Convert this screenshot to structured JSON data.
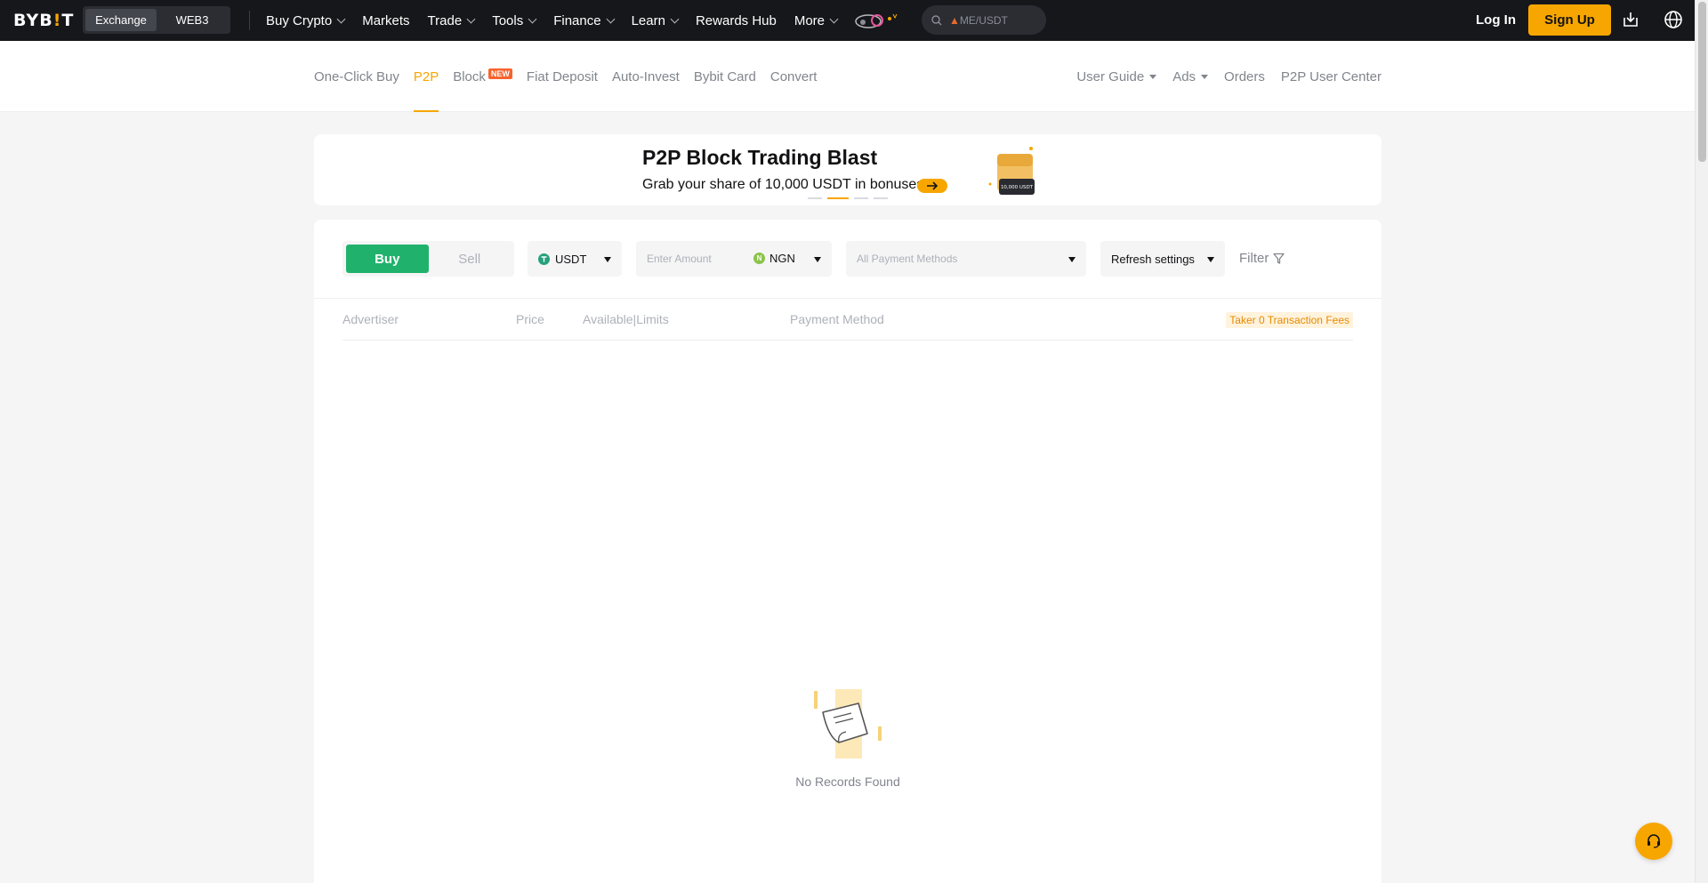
{
  "topnav": {
    "logo_main": "BYB",
    "logo_bar": "!",
    "logo_end": "T",
    "switch": [
      {
        "label": "Exchange",
        "active": true
      },
      {
        "label": "WEB3",
        "active": false
      }
    ],
    "items": [
      {
        "label": "Buy Crypto",
        "dropdown": true
      },
      {
        "label": "Markets",
        "dropdown": false
      },
      {
        "label": "Trade",
        "dropdown": true
      },
      {
        "label": "Tools",
        "dropdown": true
      },
      {
        "label": "Finance",
        "dropdown": true
      },
      {
        "label": "Learn",
        "dropdown": true
      },
      {
        "label": "Rewards Hub",
        "dropdown": false
      },
      {
        "label": "More",
        "dropdown": true
      }
    ],
    "search_placeholder": "ME/USDT",
    "login_label": "Log In",
    "signup_label": "Sign Up"
  },
  "subnav": {
    "left": [
      {
        "label": "One-Click Buy",
        "active": false
      },
      {
        "label": "P2P",
        "active": true
      },
      {
        "label": "Block",
        "active": false,
        "badge": "NEW"
      },
      {
        "label": "Fiat Deposit",
        "active": false
      },
      {
        "label": "Auto-Invest",
        "active": false
      },
      {
        "label": "Bybit Card",
        "active": false
      },
      {
        "label": "Convert",
        "active": false
      }
    ],
    "right": [
      {
        "label": "User Guide",
        "dropdown": true
      },
      {
        "label": "Ads",
        "dropdown": true
      },
      {
        "label": "Orders",
        "dropdown": false
      },
      {
        "label": "P2P User Center",
        "dropdown": false
      }
    ]
  },
  "banner": {
    "title": "P2P Block Trading Blast",
    "subtitle": "Grab your share of 10,000 USDT in bonuses!",
    "image_text": "10,000 USDT",
    "slide_active": 2,
    "slide_count": 4
  },
  "filters": {
    "buy_label": "Buy",
    "sell_label": "Sell",
    "mode": "Buy",
    "coin": "USDT",
    "amount_placeholder": "Enter Amount",
    "fiat": "NGN",
    "fiat_icon_letter": "N",
    "payment_placeholder": "All Payment Methods",
    "refresh_label": "Refresh settings",
    "filter_label": "Filter"
  },
  "table": {
    "columns": [
      "Advertiser",
      "Price",
      "Available|Limits",
      "Payment Method"
    ],
    "fees_badge": "Taker 0 Transaction Fees",
    "rows": [],
    "empty_text": "No Records Found"
  },
  "colors": {
    "brand": "#f7a600",
    "buy": "#20b26c",
    "nav_bg": "#16171b"
  }
}
